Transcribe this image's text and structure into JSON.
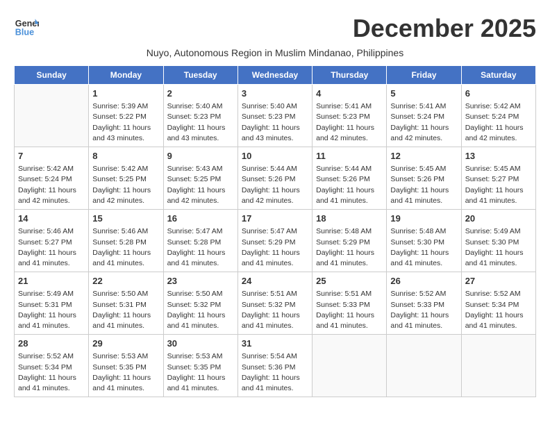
{
  "header": {
    "logo_line1": "General",
    "logo_line2": "Blue",
    "month_title": "December 2025",
    "subtitle": "Nuyo, Autonomous Region in Muslim Mindanao, Philippines"
  },
  "weekdays": [
    "Sunday",
    "Monday",
    "Tuesday",
    "Wednesday",
    "Thursday",
    "Friday",
    "Saturday"
  ],
  "weeks": [
    [
      {
        "day": "",
        "sunrise": "",
        "sunset": "",
        "daylight": ""
      },
      {
        "day": "1",
        "sunrise": "Sunrise: 5:39 AM",
        "sunset": "Sunset: 5:22 PM",
        "daylight": "Daylight: 11 hours and 43 minutes."
      },
      {
        "day": "2",
        "sunrise": "Sunrise: 5:40 AM",
        "sunset": "Sunset: 5:23 PM",
        "daylight": "Daylight: 11 hours and 43 minutes."
      },
      {
        "day": "3",
        "sunrise": "Sunrise: 5:40 AM",
        "sunset": "Sunset: 5:23 PM",
        "daylight": "Daylight: 11 hours and 43 minutes."
      },
      {
        "day": "4",
        "sunrise": "Sunrise: 5:41 AM",
        "sunset": "Sunset: 5:23 PM",
        "daylight": "Daylight: 11 hours and 42 minutes."
      },
      {
        "day": "5",
        "sunrise": "Sunrise: 5:41 AM",
        "sunset": "Sunset: 5:24 PM",
        "daylight": "Daylight: 11 hours and 42 minutes."
      },
      {
        "day": "6",
        "sunrise": "Sunrise: 5:42 AM",
        "sunset": "Sunset: 5:24 PM",
        "daylight": "Daylight: 11 hours and 42 minutes."
      }
    ],
    [
      {
        "day": "7",
        "sunrise": "Sunrise: 5:42 AM",
        "sunset": "Sunset: 5:24 PM",
        "daylight": "Daylight: 11 hours and 42 minutes."
      },
      {
        "day": "8",
        "sunrise": "Sunrise: 5:42 AM",
        "sunset": "Sunset: 5:25 PM",
        "daylight": "Daylight: 11 hours and 42 minutes."
      },
      {
        "day": "9",
        "sunrise": "Sunrise: 5:43 AM",
        "sunset": "Sunset: 5:25 PM",
        "daylight": "Daylight: 11 hours and 42 minutes."
      },
      {
        "day": "10",
        "sunrise": "Sunrise: 5:44 AM",
        "sunset": "Sunset: 5:26 PM",
        "daylight": "Daylight: 11 hours and 42 minutes."
      },
      {
        "day": "11",
        "sunrise": "Sunrise: 5:44 AM",
        "sunset": "Sunset: 5:26 PM",
        "daylight": "Daylight: 11 hours and 41 minutes."
      },
      {
        "day": "12",
        "sunrise": "Sunrise: 5:45 AM",
        "sunset": "Sunset: 5:26 PM",
        "daylight": "Daylight: 11 hours and 41 minutes."
      },
      {
        "day": "13",
        "sunrise": "Sunrise: 5:45 AM",
        "sunset": "Sunset: 5:27 PM",
        "daylight": "Daylight: 11 hours and 41 minutes."
      }
    ],
    [
      {
        "day": "14",
        "sunrise": "Sunrise: 5:46 AM",
        "sunset": "Sunset: 5:27 PM",
        "daylight": "Daylight: 11 hours and 41 minutes."
      },
      {
        "day": "15",
        "sunrise": "Sunrise: 5:46 AM",
        "sunset": "Sunset: 5:28 PM",
        "daylight": "Daylight: 11 hours and 41 minutes."
      },
      {
        "day": "16",
        "sunrise": "Sunrise: 5:47 AM",
        "sunset": "Sunset: 5:28 PM",
        "daylight": "Daylight: 11 hours and 41 minutes."
      },
      {
        "day": "17",
        "sunrise": "Sunrise: 5:47 AM",
        "sunset": "Sunset: 5:29 PM",
        "daylight": "Daylight: 11 hours and 41 minutes."
      },
      {
        "day": "18",
        "sunrise": "Sunrise: 5:48 AM",
        "sunset": "Sunset: 5:29 PM",
        "daylight": "Daylight: 11 hours and 41 minutes."
      },
      {
        "day": "19",
        "sunrise": "Sunrise: 5:48 AM",
        "sunset": "Sunset: 5:30 PM",
        "daylight": "Daylight: 11 hours and 41 minutes."
      },
      {
        "day": "20",
        "sunrise": "Sunrise: 5:49 AM",
        "sunset": "Sunset: 5:30 PM",
        "daylight": "Daylight: 11 hours and 41 minutes."
      }
    ],
    [
      {
        "day": "21",
        "sunrise": "Sunrise: 5:49 AM",
        "sunset": "Sunset: 5:31 PM",
        "daylight": "Daylight: 11 hours and 41 minutes."
      },
      {
        "day": "22",
        "sunrise": "Sunrise: 5:50 AM",
        "sunset": "Sunset: 5:31 PM",
        "daylight": "Daylight: 11 hours and 41 minutes."
      },
      {
        "day": "23",
        "sunrise": "Sunrise: 5:50 AM",
        "sunset": "Sunset: 5:32 PM",
        "daylight": "Daylight: 11 hours and 41 minutes."
      },
      {
        "day": "24",
        "sunrise": "Sunrise: 5:51 AM",
        "sunset": "Sunset: 5:32 PM",
        "daylight": "Daylight: 11 hours and 41 minutes."
      },
      {
        "day": "25",
        "sunrise": "Sunrise: 5:51 AM",
        "sunset": "Sunset: 5:33 PM",
        "daylight": "Daylight: 11 hours and 41 minutes."
      },
      {
        "day": "26",
        "sunrise": "Sunrise: 5:52 AM",
        "sunset": "Sunset: 5:33 PM",
        "daylight": "Daylight: 11 hours and 41 minutes."
      },
      {
        "day": "27",
        "sunrise": "Sunrise: 5:52 AM",
        "sunset": "Sunset: 5:34 PM",
        "daylight": "Daylight: 11 hours and 41 minutes."
      }
    ],
    [
      {
        "day": "28",
        "sunrise": "Sunrise: 5:52 AM",
        "sunset": "Sunset: 5:34 PM",
        "daylight": "Daylight: 11 hours and 41 minutes."
      },
      {
        "day": "29",
        "sunrise": "Sunrise: 5:53 AM",
        "sunset": "Sunset: 5:35 PM",
        "daylight": "Daylight: 11 hours and 41 minutes."
      },
      {
        "day": "30",
        "sunrise": "Sunrise: 5:53 AM",
        "sunset": "Sunset: 5:35 PM",
        "daylight": "Daylight: 11 hours and 41 minutes."
      },
      {
        "day": "31",
        "sunrise": "Sunrise: 5:54 AM",
        "sunset": "Sunset: 5:36 PM",
        "daylight": "Daylight: 11 hours and 41 minutes."
      },
      {
        "day": "",
        "sunrise": "",
        "sunset": "",
        "daylight": ""
      },
      {
        "day": "",
        "sunrise": "",
        "sunset": "",
        "daylight": ""
      },
      {
        "day": "",
        "sunrise": "",
        "sunset": "",
        "daylight": ""
      }
    ]
  ]
}
